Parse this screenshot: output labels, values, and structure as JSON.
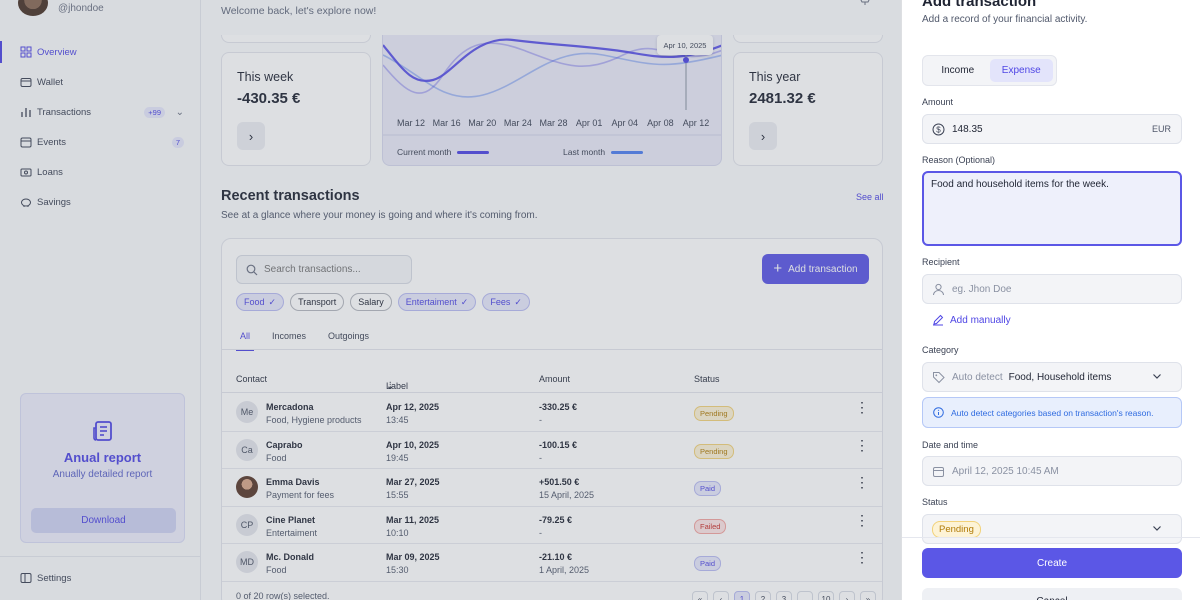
{
  "user": {
    "handle": "@jhondoe"
  },
  "sidebar": {
    "items": [
      {
        "label": "Overview",
        "icon": "grid-icon",
        "active": true
      },
      {
        "label": "Wallet",
        "icon": "wallet-icon"
      },
      {
        "label": "Transactions",
        "icon": "bar-chart-icon",
        "badge": "+99"
      },
      {
        "label": "Events",
        "icon": "calendar-icon",
        "badge": "7"
      },
      {
        "label": "Loans",
        "icon": "loan-icon"
      },
      {
        "label": "Savings",
        "icon": "piggy-bank-icon"
      }
    ],
    "report": {
      "title": "Anual report",
      "subtitle": "Anually detailed report",
      "button": "Download"
    },
    "settings": "Settings"
  },
  "header": {
    "welcome": "Welcome back, let's explore now!"
  },
  "stats": {
    "week": {
      "label": "This week",
      "value": "-430.35 €"
    },
    "year": {
      "label": "This year",
      "value": "2481.32 €"
    }
  },
  "chart_data": {
    "type": "line",
    "x": [
      "Mar 12",
      "Mar 16",
      "Mar 20",
      "Mar 24",
      "Mar 28",
      "Apr 01",
      "Apr 04",
      "Apr 08",
      "Apr 12"
    ],
    "series": [
      {
        "name": "Current month",
        "color": "#4f46e5"
      },
      {
        "name": "Last month",
        "color": "#4f7ff0"
      }
    ],
    "tooltip": {
      "date": "Apr 10, 2025"
    }
  },
  "transactions": {
    "title": "Recent transactions",
    "subtitle": "See at a glance where your money is going and where it's coming from.",
    "see_all": "See all",
    "search_placeholder": "Search transactions...",
    "add_button": "Add transaction",
    "chips": [
      {
        "label": "Food",
        "selected": true
      },
      {
        "label": "Transport",
        "selected": false
      },
      {
        "label": "Salary",
        "selected": false
      },
      {
        "label": "Entertaiment",
        "selected": true
      },
      {
        "label": "Fees",
        "selected": true
      }
    ],
    "tabs": [
      "All",
      "Incomes",
      "Outgoings"
    ],
    "columns": {
      "contact": "Contact",
      "label": "Label",
      "amount": "Amount",
      "status": "Status"
    },
    "rows": [
      {
        "initials": "Me",
        "name": "Mercadona",
        "sub": "Food, Hygiene products",
        "date": "Apr 12, 2025",
        "time": "13:45",
        "amount": "-330.25 €",
        "amount_sub": "-",
        "status": "Pending",
        "status_class": "pending"
      },
      {
        "initials": "Ca",
        "name": "Caprabo",
        "sub": "Food",
        "date": "Apr 10, 2025",
        "time": "19:45",
        "amount": "-100.15 €",
        "amount_sub": "-",
        "status": "Pending",
        "status_class": "pending"
      },
      {
        "initials": "",
        "name": "Emma Davis",
        "sub": "Payment for fees",
        "date": "Mar 27, 2025",
        "time": "15:55",
        "amount": "+501.50 €",
        "amount_sub": "15 April, 2025",
        "status": "Paid",
        "status_class": "paid",
        "photo": true
      },
      {
        "initials": "CP",
        "name": "Cine Planet",
        "sub": "Entertaiment",
        "date": "Mar 11, 2025",
        "time": "10:10",
        "amount": "-79.25 €",
        "amount_sub": "-",
        "status": "Failed",
        "status_class": "failed"
      },
      {
        "initials": "MD",
        "name": "Mc. Donald",
        "sub": "Food",
        "date": "Mar 09, 2025",
        "time": "15:30",
        "amount": "-21.10 €",
        "amount_sub": "1 April, 2025",
        "status": "Paid",
        "status_class": "paid"
      }
    ],
    "footer": "0 of 20 row(s) selected.",
    "pagination": [
      "«",
      "‹",
      "1",
      "2",
      "3",
      "…",
      "10",
      "›",
      "»"
    ]
  },
  "panel": {
    "title": "Add transaction",
    "subtitle": "Add a record of your financial activity.",
    "type_options": [
      "Income",
      "Expense"
    ],
    "amount": {
      "label": "Amount",
      "value": "148.35",
      "currency": "EUR"
    },
    "reason": {
      "label": "Reason (Optional)",
      "value": "Food and household items for the week."
    },
    "recipient": {
      "label": "Recipient",
      "placeholder": "eg. Jhon Doe",
      "add_manually": "Add manually"
    },
    "category": {
      "label": "Category",
      "auto": "Auto detect",
      "value": "Food, Household items",
      "info": "Auto detect categories based on transaction's reason."
    },
    "date": {
      "label": "Date and time",
      "value": "April 12, 2025 10:45 AM"
    },
    "status": {
      "label": "Status",
      "value": "Pending"
    },
    "create": "Create",
    "cancel": "Cancel"
  }
}
